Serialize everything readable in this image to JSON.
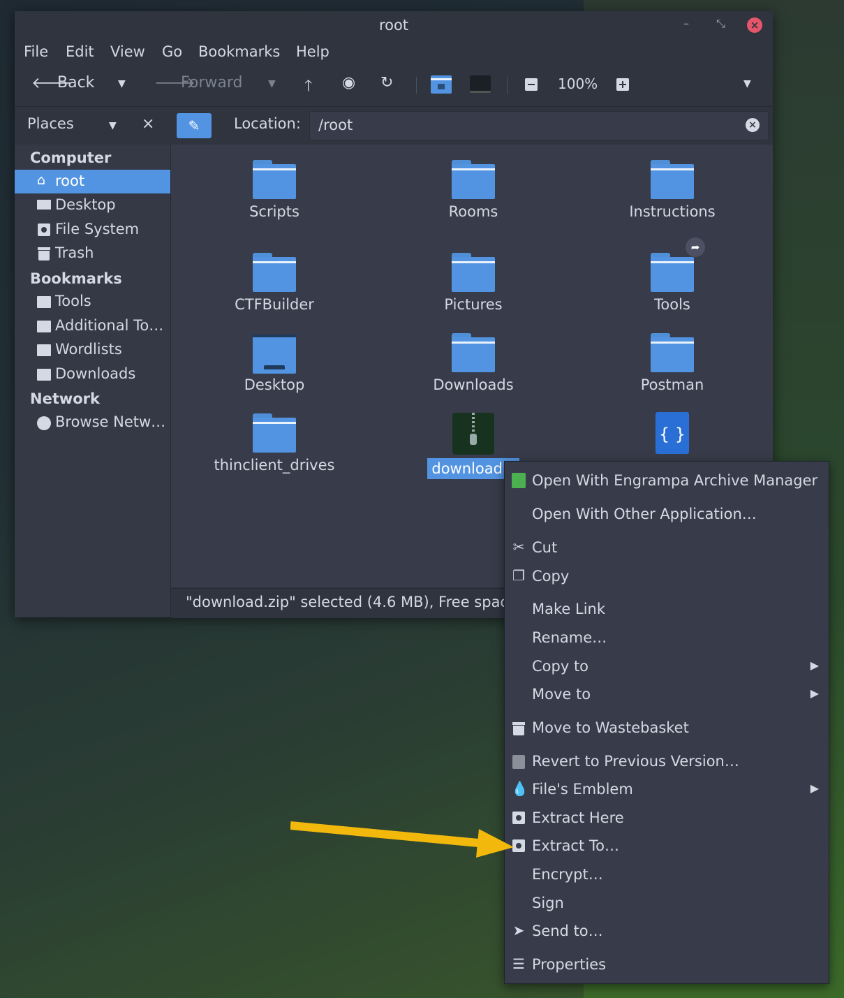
{
  "window": {
    "title": "root"
  },
  "menubar": [
    "File",
    "Edit",
    "View",
    "Go",
    "Bookmarks",
    "Help"
  ],
  "toolbar": {
    "back_label": "Back",
    "forward_label": "Forward",
    "zoom": "100%"
  },
  "location": {
    "places_label": "Places",
    "label": "Location:",
    "value": "/root"
  },
  "sidebar": {
    "sections": [
      {
        "title": "Computer",
        "items": [
          {
            "label": "root",
            "icon": "home-icon",
            "selected": true
          },
          {
            "label": "Desktop",
            "icon": "desktop-icon"
          },
          {
            "label": "File System",
            "icon": "drive-icon"
          },
          {
            "label": "Trash",
            "icon": "trash-icon"
          }
        ]
      },
      {
        "title": "Bookmarks",
        "items": [
          {
            "label": "Tools",
            "icon": "folder-icon"
          },
          {
            "label": "Additional To…",
            "icon": "folder-icon"
          },
          {
            "label": "Wordlists",
            "icon": "folder-icon"
          },
          {
            "label": "Downloads",
            "icon": "folder-icon"
          }
        ]
      },
      {
        "title": "Network",
        "items": [
          {
            "label": "Browse Netw…",
            "icon": "network-icon"
          }
        ]
      }
    ]
  },
  "files": [
    {
      "name": "Scripts",
      "type": "folder"
    },
    {
      "name": "Rooms",
      "type": "folder"
    },
    {
      "name": "Instructions",
      "type": "folder"
    },
    {
      "name": "CTFBuilder",
      "type": "folder"
    },
    {
      "name": "Pictures",
      "type": "folder"
    },
    {
      "name": "Tools",
      "type": "folder-link"
    },
    {
      "name": "Desktop",
      "type": "desktop-folder"
    },
    {
      "name": "Downloads",
      "type": "folder"
    },
    {
      "name": "Postman",
      "type": "folder"
    },
    {
      "name": "thinclient_drives",
      "type": "folder"
    },
    {
      "name": "download.zip",
      "display": "download.z",
      "type": "archive",
      "selected": true
    },
    {
      "name": "",
      "type": "json-file"
    }
  ],
  "status": "\"download.zip\" selected (4.6 MB), Free space:",
  "context_menu": [
    {
      "label": "Open With Engrampa Archive Manager",
      "icon": "engrampa-icon"
    },
    {
      "label": "Open With Other Application…"
    },
    {
      "label": "Cut",
      "icon": "scissors-icon"
    },
    {
      "label": "Copy",
      "icon": "copy-icon"
    },
    {
      "label": "Make Link"
    },
    {
      "label": "Rename…"
    },
    {
      "label": "Copy to",
      "submenu": true
    },
    {
      "label": "Move to",
      "submenu": true
    },
    {
      "label": "Move to Wastebasket",
      "icon": "trash-icon"
    },
    {
      "label": "Revert to Previous Version…",
      "icon": "revert-icon"
    },
    {
      "label": "File's Emblem",
      "icon": "emblem-icon",
      "submenu": true
    },
    {
      "label": "Extract Here",
      "icon": "extract-icon"
    },
    {
      "label": "Extract To…",
      "icon": "extract-icon"
    },
    {
      "label": "Encrypt…"
    },
    {
      "label": "Sign"
    },
    {
      "label": "Send to…",
      "icon": "send-icon"
    },
    {
      "label": "Properties",
      "icon": "properties-icon"
    }
  ],
  "colors": {
    "accent": "#5294e2",
    "arrow": "#f2b90c",
    "bg": "#383c4a"
  }
}
